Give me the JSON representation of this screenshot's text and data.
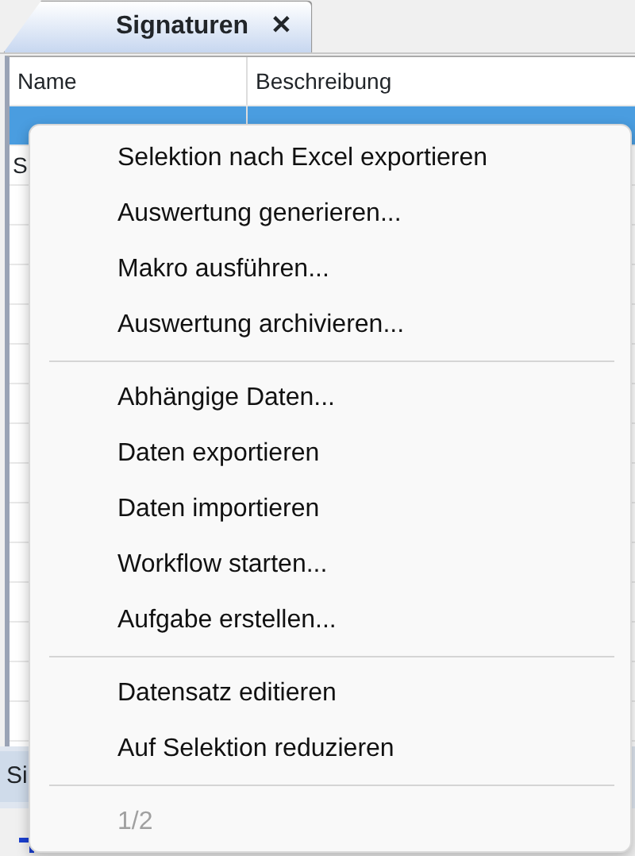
{
  "tabs": [
    {
      "label": "Signaturen",
      "selected": true,
      "close": "✕"
    }
  ],
  "table": {
    "columns": [
      "Name",
      "Beschreibung"
    ],
    "rows": [
      {
        "selected": true
      },
      {
        "name": "S",
        "selected": false
      }
    ]
  },
  "bottom_tabs": [
    {
      "label": "Si",
      "selected": false
    }
  ],
  "context_menu": {
    "items": [
      {
        "kind": "item",
        "label": "Selektion nach Excel exportieren",
        "disabled": false
      },
      {
        "kind": "item",
        "label": "Auswertung generieren...",
        "disabled": false
      },
      {
        "kind": "item",
        "label": "Makro ausführen...",
        "disabled": false
      },
      {
        "kind": "item",
        "label": "Auswertung archivieren...",
        "disabled": false
      },
      {
        "kind": "separator"
      },
      {
        "kind": "item",
        "label": "Abhängige Daten...",
        "disabled": false
      },
      {
        "kind": "item",
        "label": "Daten exportieren",
        "disabled": false
      },
      {
        "kind": "item",
        "label": "Daten importieren",
        "disabled": false
      },
      {
        "kind": "item",
        "label": "Workflow starten...",
        "disabled": false
      },
      {
        "kind": "item",
        "label": "Aufgabe erstellen...",
        "disabled": false
      },
      {
        "kind": "separator"
      },
      {
        "kind": "item",
        "label": "Datensatz editieren",
        "disabled": false
      },
      {
        "kind": "item",
        "label": "Auf Selektion reduzieren",
        "disabled": false
      },
      {
        "kind": "separator"
      },
      {
        "kind": "item",
        "label": "1/2",
        "disabled": true
      }
    ]
  }
}
